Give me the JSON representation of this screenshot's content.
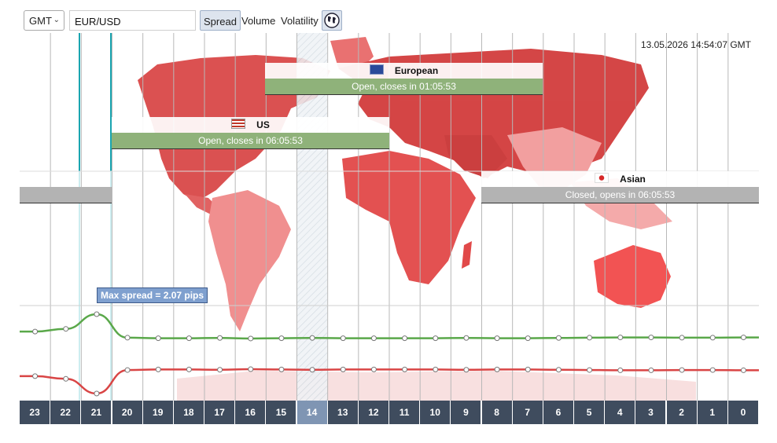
{
  "toolbar": {
    "timezone": "GMT",
    "pair": "EUR/USD",
    "modes": [
      "Spread",
      "Volume",
      "Volatility"
    ],
    "active_mode": "Spread"
  },
  "timestamp": "13.05.2026 14:54:07 GMT",
  "sessions": {
    "european": {
      "name": "European",
      "status": "Open, closes in 01:05:53"
    },
    "us": {
      "name": "US",
      "status": "Open, closes in 06:05:53"
    },
    "asian": {
      "name": "Asian",
      "status": "Closed, opens in 06:05:53"
    }
  },
  "tooltip": "Max spread = 2.07 pips",
  "hours": [
    "23",
    "22",
    "21",
    "20",
    "19",
    "18",
    "17",
    "16",
    "15",
    "14",
    "13",
    "12",
    "11",
    "10",
    "9",
    "8",
    "7",
    "6",
    "5",
    "4",
    "3",
    "2",
    "1",
    "0"
  ],
  "current_hour": "14",
  "colors": {
    "green_line": "#5aa84a",
    "red_line": "#d94545",
    "open": "#8fb27a",
    "closed": "#b3b3b3",
    "map": "#e05a5a"
  },
  "chart_data": {
    "type": "line",
    "x": [
      "23",
      "22",
      "21",
      "20",
      "19",
      "18",
      "17",
      "16",
      "15",
      "14",
      "13",
      "12",
      "11",
      "10",
      "9",
      "8",
      "7",
      "6",
      "5",
      "4",
      "3",
      "2",
      "1",
      "0"
    ],
    "series": [
      {
        "values": [
          0.35,
          0.45,
          1.0,
          0.12,
          0.1,
          0.1,
          0.11,
          0.09,
          0.1,
          0.11,
          0.1,
          0.1,
          0.1,
          0.1,
          0.11,
          0.1,
          0.1,
          0.11,
          0.12,
          0.13,
          0.13,
          0.12,
          0.12,
          0.13
        ]
      },
      {
        "values": [
          0.35,
          0.45,
          1.0,
          0.12,
          0.1,
          0.1,
          0.11,
          0.09,
          0.1,
          0.11,
          0.1,
          0.1,
          0.1,
          0.1,
          0.11,
          0.1,
          0.1,
          0.11,
          0.12,
          0.13,
          0.13,
          0.12,
          0.12,
          0.13
        ]
      }
    ]
  }
}
